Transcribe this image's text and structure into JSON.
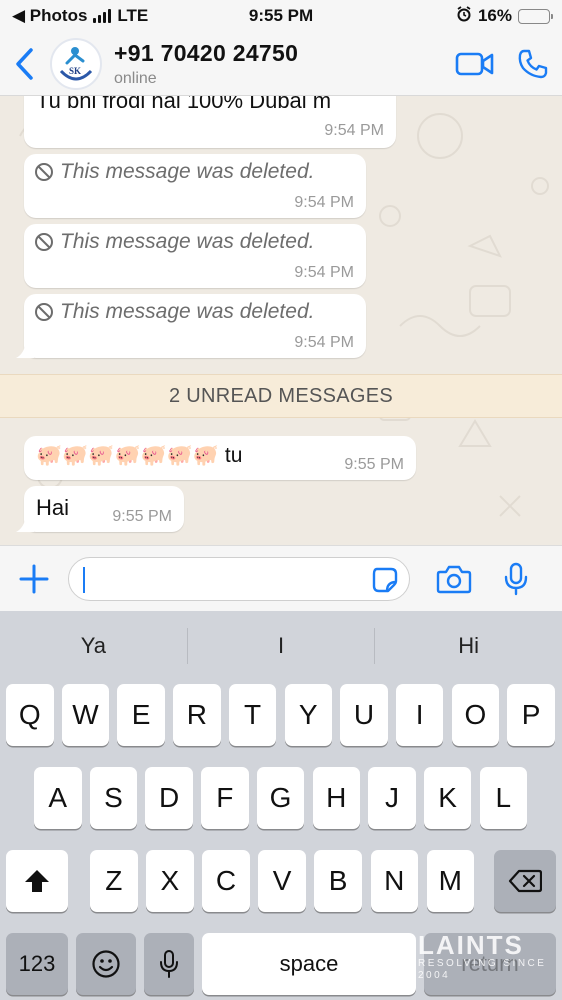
{
  "status_bar": {
    "back_app": "◀ Photos",
    "network": "LTE",
    "time": "9:55 PM",
    "battery": "16%",
    "battery_level": 0.16
  },
  "header": {
    "contact_name": "+91 70420 24750",
    "contact_status": "online",
    "avatar_text": "SK"
  },
  "messages": [
    {
      "type": "text",
      "text": "Tu bhi frodi hai 100% Dubai m",
      "time": "9:54 PM"
    },
    {
      "type": "deleted",
      "text": "This message was deleted.",
      "time": "9:54 PM"
    },
    {
      "type": "deleted",
      "text": "This message was deleted.",
      "time": "9:54 PM"
    },
    {
      "type": "deleted",
      "text": "This message was deleted.",
      "time": "9:54 PM"
    },
    {
      "type": "text",
      "text": "🐖🐖🐖🐖🐖🐖🐖 tu",
      "time": "9:55 PM"
    },
    {
      "type": "text",
      "text": "Hai",
      "time": "9:55 PM"
    }
  ],
  "unread_banner": "2 UNREAD MESSAGES",
  "input": {
    "value": "",
    "placeholder": ""
  },
  "keyboard": {
    "suggestions": [
      "Ya",
      "I",
      "Hi"
    ],
    "row1": [
      "Q",
      "W",
      "E",
      "R",
      "T",
      "Y",
      "U",
      "I",
      "O",
      "P"
    ],
    "row2": [
      "A",
      "S",
      "D",
      "F",
      "G",
      "H",
      "J",
      "K",
      "L"
    ],
    "row3": [
      "Z",
      "X",
      "C",
      "V",
      "B",
      "N",
      "M"
    ],
    "numbers_label": "123",
    "space_label": "space",
    "return_label": "return"
  },
  "watermark": {
    "main": "LAINTS",
    "sub": "RESOLVING SINCE 2004"
  },
  "colors": {
    "accent": "#1a7cf5",
    "chat_bg": "#efeae2",
    "unread_bg": "#f7ecd9"
  }
}
